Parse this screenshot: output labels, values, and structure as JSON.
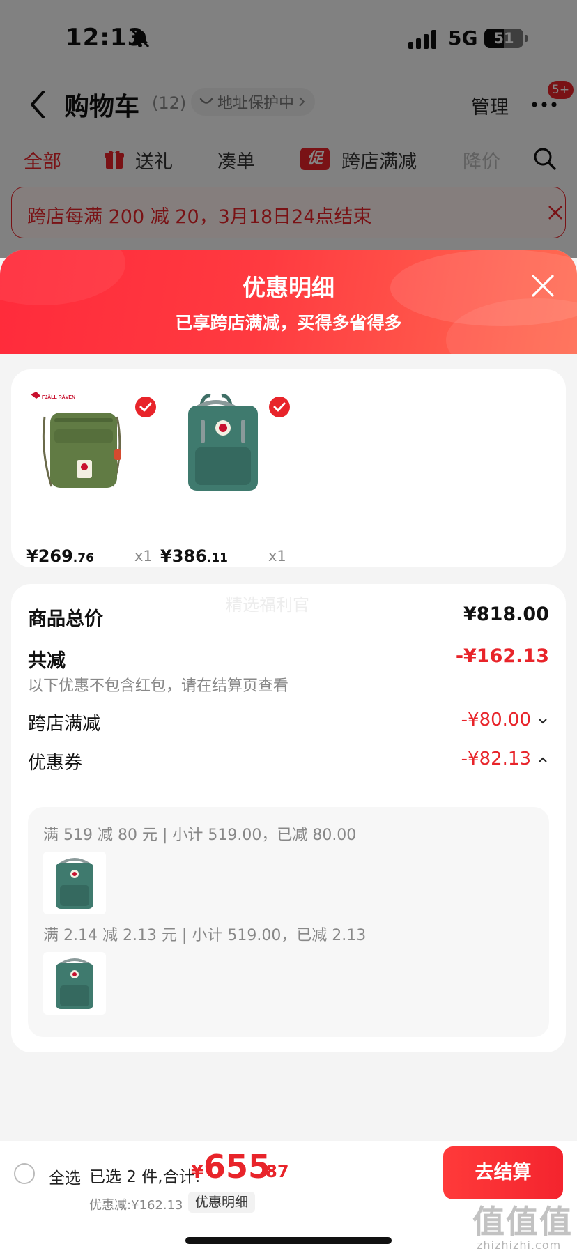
{
  "status_bar": {
    "time": "12:13",
    "network": "5G",
    "battery": "51"
  },
  "nav": {
    "title": "购物车",
    "count": "(12)",
    "address_pill": "地址保护中",
    "manage": "管理",
    "badge": "5+"
  },
  "tabs": [
    "全部",
    "送礼",
    "凑单",
    "跨店满减",
    "降价"
  ],
  "tab_cu_label": "促",
  "promo_banner": "跨店每满 200 减 20，3月18日24点结束",
  "sheet": {
    "title": "优惠明细",
    "subtitle": "已享跨店满减，买得多省得多"
  },
  "products": [
    {
      "price_int": "¥269",
      "price_dec": ".76",
      "qty": "x1",
      "brand": "FJÄLL RÄVEN"
    },
    {
      "price_int": "¥386",
      "price_dec": ".11",
      "qty": "x1"
    }
  ],
  "summary": {
    "total_label": "商品总价",
    "total_value": "¥818.00",
    "discount_label": "共减",
    "discount_value": "-¥162.13",
    "note": "以下优惠不包含红包，请在结算页查看",
    "cross_store_label": "跨店满减",
    "cross_store_value": "-¥80.00",
    "coupon_label": "优惠券",
    "coupon_value": "-¥82.13"
  },
  "coupon_details": [
    "满 519 减 80 元 | 小计 519.00，已减 80.00",
    "满 2.14 减 2.13 元 | 小计 519.00，已减 2.13"
  ],
  "watermark": "精选福利官",
  "bottom": {
    "select_all": "全选",
    "selected_info": "已选 2 件,合计:",
    "total_symbol": "¥",
    "total_int": "655",
    "total_dec": ".87",
    "saved": "优惠减:¥162.13",
    "detail_chip": "优惠明细",
    "checkout": "去结算",
    "site_mark": "值值值",
    "site_url": "zhizhizhi.com"
  },
  "colors": {
    "accent": "#e8242a",
    "bag1": "#5f7a3e",
    "bag2": "#3f7a6e"
  }
}
